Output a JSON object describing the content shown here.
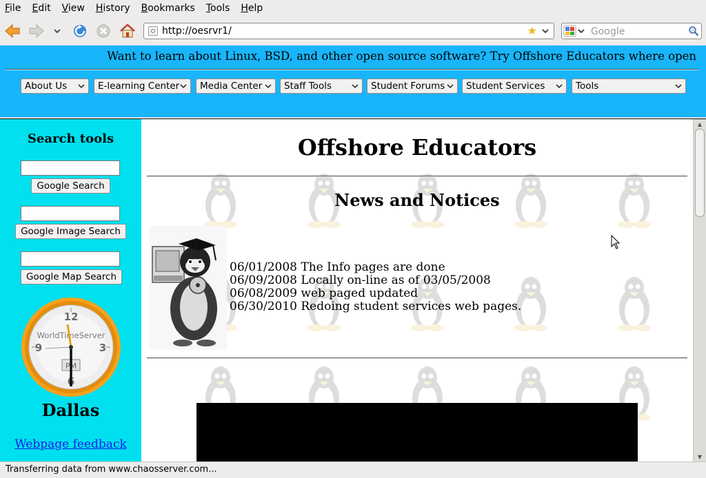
{
  "menu": [
    "File",
    "Edit",
    "View",
    "History",
    "Bookmarks",
    "Tools",
    "Help"
  ],
  "toolbar": {
    "url": "http://oesrvr1/",
    "search_placeholder": "Google"
  },
  "banner": {
    "marquee": "Want to learn about Linux, BSD, and other open source software? Try Offshore Educators where open",
    "nav_selects": [
      "About Us",
      "E-learning Center",
      "Media Center",
      "Staff Tools",
      "Student Forums",
      "Student Services",
      "Tools"
    ]
  },
  "sidebar": {
    "heading": "Search tools",
    "buttons": [
      "Google Search",
      "Google Image Search",
      "Google Map Search"
    ],
    "clock": {
      "brand": "WorldTimeServer",
      "ampm": "PM",
      "numbers": [
        "12",
        "3",
        "6",
        "9"
      ]
    },
    "city": "Dallas",
    "feedback": "Webpage feedback"
  },
  "content": {
    "title": "Offshore Educators",
    "subtitle": "News and Notices",
    "news": [
      "06/01/2008 The Info pages are done",
      "06/09/2008 Locally on-line as of 03/05/2008",
      "06/08/2009 web paged updated",
      "06/30/2010 Redoing student services web pages."
    ]
  },
  "status": "Transferring data from www.chaosserver.com...",
  "colors": {
    "banner": "#19b5fb",
    "sidebar": "#00e0ee",
    "clock_ring": "#f7a21b"
  }
}
